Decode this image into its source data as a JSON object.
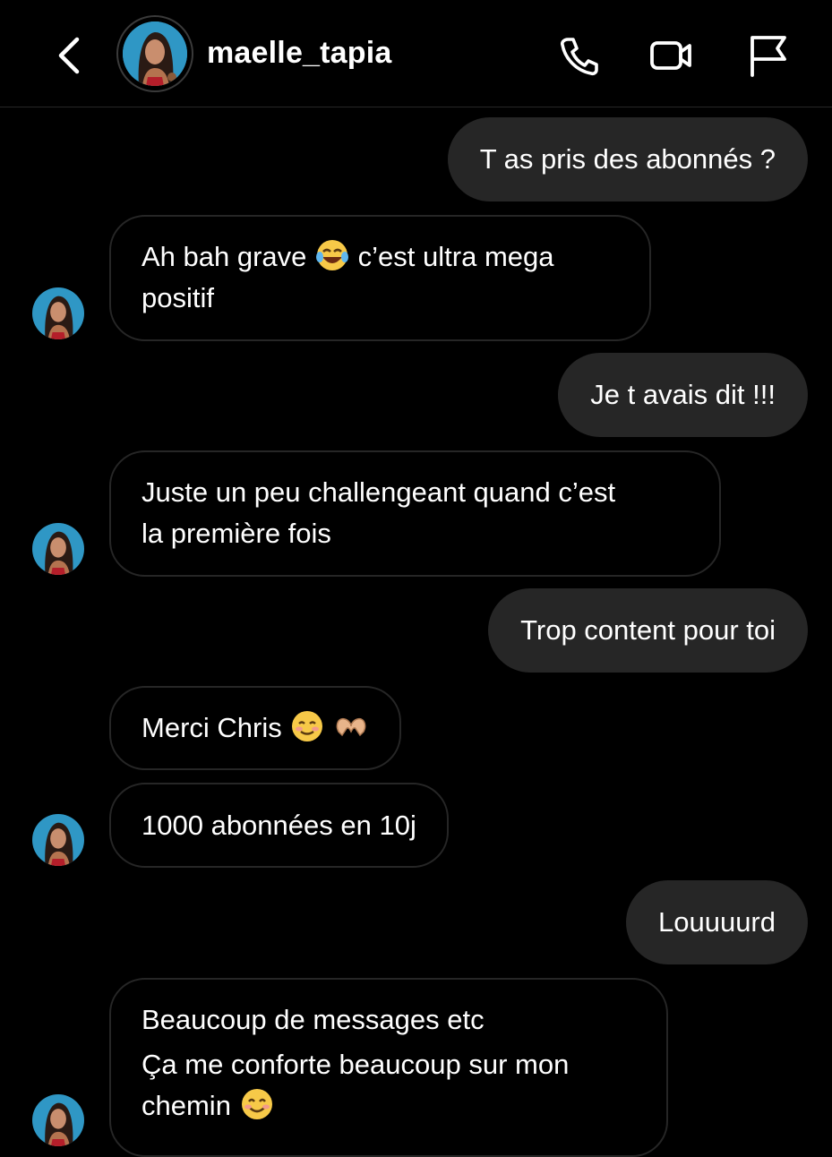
{
  "header": {
    "username": "maelle_tapia",
    "back_icon": "chevron-left-icon",
    "actions": [
      {
        "name": "call-button",
        "icon": "phone-icon"
      },
      {
        "name": "video-call-button",
        "icon": "video-camera-icon"
      },
      {
        "name": "report-button",
        "icon": "flag-icon"
      }
    ]
  },
  "messages": {
    "m1": {
      "text": "T as pris des abonnés ?"
    },
    "m2": {
      "line1a": "Ah bah grave",
      "line1b": "c’est ultra mega",
      "line2": "positif",
      "emoji": "face-with-tears-of-joy-icon"
    },
    "m3": {
      "text": "Je t avais dit !!!"
    },
    "m4": {
      "line1": "Juste un peu challengeant quand c’est",
      "line2": "la première fois"
    },
    "m5": {
      "text": "Trop content pour toi"
    },
    "m6": {
      "text": "Merci Chris",
      "emoji1": "smiling-face-icon",
      "emoji2": "heart-hands-icon"
    },
    "m7": {
      "text": "1000 abonnées en 10j"
    },
    "m8": {
      "text": "Louuuurd"
    },
    "m9": {
      "line1": "Beaucoup de messages etc",
      "line2": "Ça me conforte beaucoup sur mon",
      "line3": "chemin",
      "emoji": "smiling-face-with-smiling-eyes-icon"
    }
  }
}
